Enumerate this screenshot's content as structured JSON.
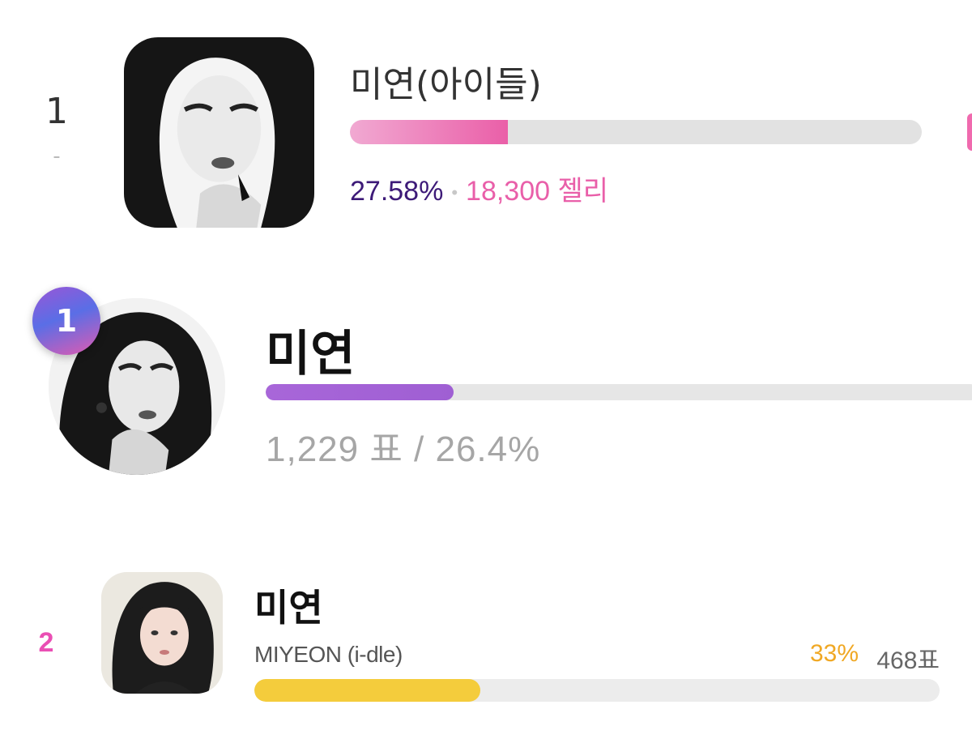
{
  "cards": [
    {
      "rank": "1",
      "rank_change": "-",
      "name": "미연(아이들)",
      "percent_text": "27.58%",
      "separator": "•",
      "jelly_text": "18,300 젤리",
      "progress_fraction": 0.2758,
      "colors": {
        "bar_start": "#f1a9d2",
        "bar_end": "#ea5fa8",
        "percent": "#3d1a78",
        "jelly": "#e95fa9"
      }
    },
    {
      "rank": "1",
      "name": "미연",
      "stats_text": "1,229 표 / 26.4%",
      "progress_fraction": 0.264,
      "colors": {
        "bar": "#a866d9",
        "badge_start": "#9a56d6",
        "badge_end": "#e15ab0"
      }
    },
    {
      "rank": "2",
      "name": "미연",
      "subname": "MIYEON (i-dle)",
      "percent_text": "33%",
      "votes_text": "468표",
      "progress_fraction": 0.33,
      "colors": {
        "bar": "#f4cc3c",
        "percent": "#f0a824",
        "rank": "#ea4fb4"
      }
    }
  ]
}
